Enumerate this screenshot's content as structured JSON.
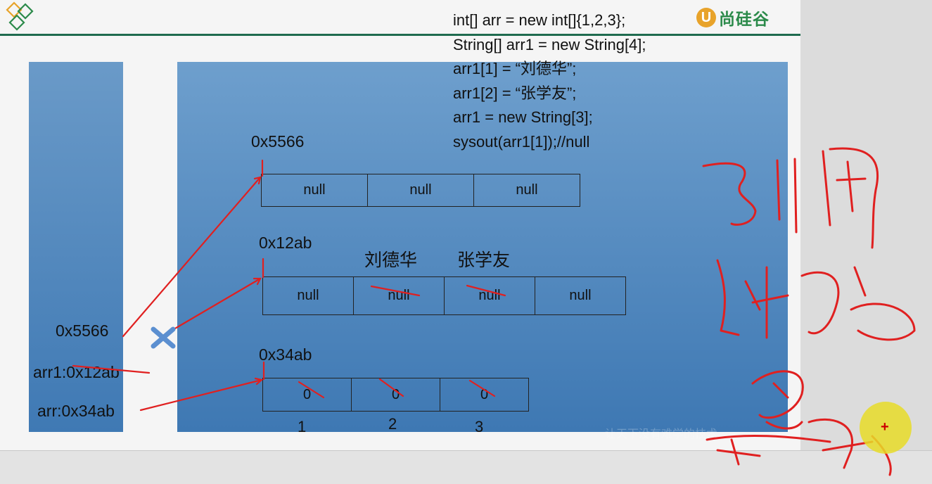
{
  "code_lines": [
    "int[] arr = new int[]{1,2,3};",
    "String[] arr1 = new String[4];",
    "arr1[1] = “刘德华”;",
    "arr1[2] = “张学友”;",
    "arr1 = new String[3];",
    "sysout(arr1[1]);//null"
  ],
  "brand": {
    "mark": "U",
    "name": "尚硅谷"
  },
  "stack": {
    "var_arr1_new": "0x5566",
    "var_arr1_old": "arr1:0x12ab",
    "var_arr": "arr:0x34ab"
  },
  "heap": {
    "array_5566": {
      "address": "0x5566",
      "cells": [
        "null",
        "null",
        "null"
      ]
    },
    "array_12ab": {
      "address": "0x12ab",
      "cells": [
        "null",
        "null",
        "null",
        "null"
      ],
      "assigned_labels": [
        "刘德华",
        "张学友"
      ]
    },
    "array_34ab": {
      "address": "0x34ab",
      "cells": [
        "0",
        "0",
        "0"
      ],
      "assigned_values": [
        "1",
        "2",
        "3"
      ]
    }
  },
  "handwriting_text": "引用 类型的 变量 赋值",
  "colors": {
    "panel_blue": "#4a84bd",
    "annotation_red": "#e02020",
    "rule_green": "#1f6b4f",
    "brand_green": "#2b8a4a",
    "cursor_yellow": "#e8dc28"
  },
  "icons": [
    "diamond-logo-icon",
    "cross-mark-icon",
    "cursor-highlight-icon"
  ]
}
